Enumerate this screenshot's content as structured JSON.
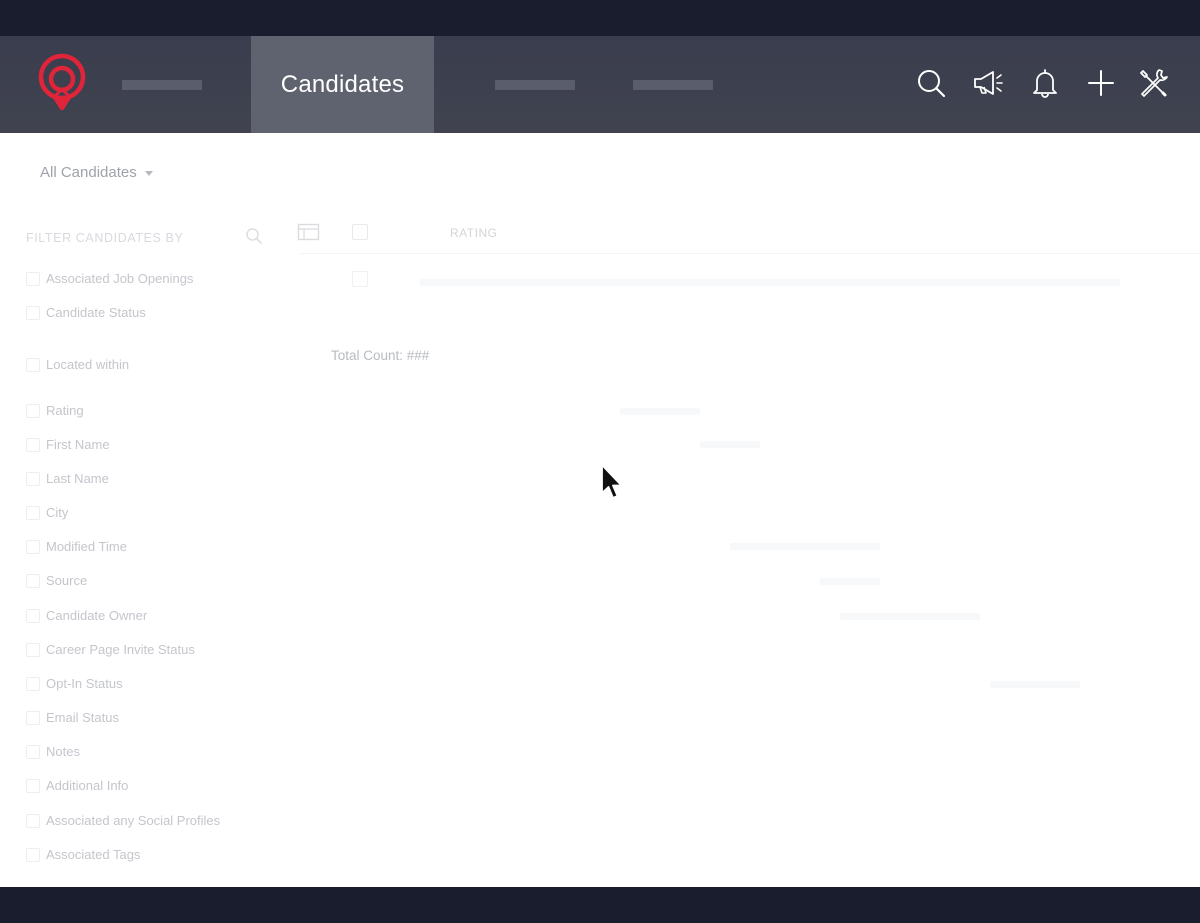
{
  "navbar": {
    "active_tab": "Candidates",
    "brand_color": "#e0243a",
    "icons": [
      "search-icon",
      "megaphone-icon",
      "bell-icon",
      "plus-icon",
      "tools-icon"
    ]
  },
  "view": {
    "label": "All Candidates"
  },
  "filters": {
    "heading": "FILTER CANDIDATES BY",
    "items": [
      "Associated Job Openings",
      "Candidate Status",
      "Located within",
      "Rating",
      "First Name",
      "Last Name",
      "City",
      "Modified Time",
      "Source",
      "Candidate Owner",
      "Career Page Invite Status",
      "Opt-In Status",
      "Email Status",
      "Notes",
      "Additional Info",
      "Associated any Social Profiles",
      "Associated Tags"
    ]
  },
  "table": {
    "column_rating": "RATING",
    "total_count": "Total Count: ###"
  }
}
